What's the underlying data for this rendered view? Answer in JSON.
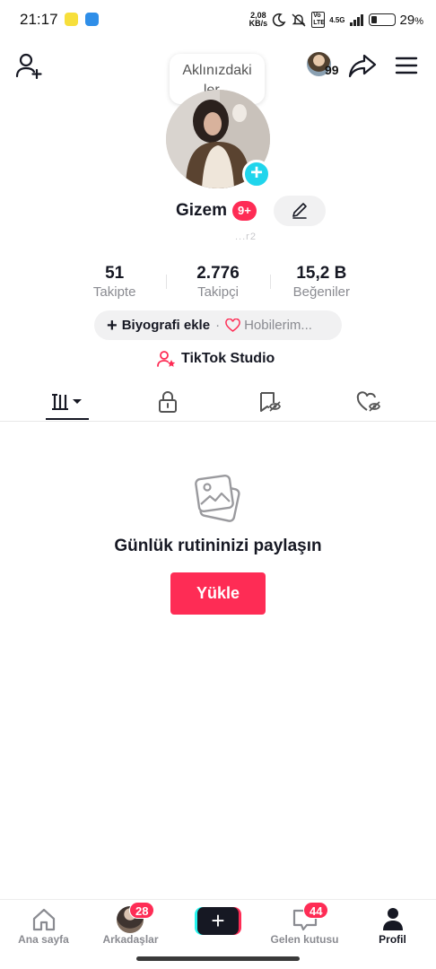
{
  "status_bar": {
    "time": "21:17",
    "net_speed_value": "2,08",
    "net_speed_unit": "KB/s",
    "network": "4.5G",
    "volte": "Vo LTE",
    "battery_percent": "29",
    "battery_symbol": "%",
    "battery_level": 0.29
  },
  "header": {
    "tooltip_line1": "Aklınızdaki",
    "tooltip_line2": "ler...",
    "views_count": "99"
  },
  "profile": {
    "name": "Gizem",
    "notification_badge": "9+",
    "faded_text": "...r2",
    "stats": [
      {
        "value": "51",
        "label": "Takipte"
      },
      {
        "value": "2.776",
        "label": "Takipçi"
      },
      {
        "value": "15,2 B",
        "label": "Beğeniler"
      }
    ],
    "bio_add": "Biyografi ekle",
    "bio_separator": "·",
    "hobbies": "Hobilerim...",
    "studio": "TikTok Studio"
  },
  "tabs": [
    {
      "icon": "videos-grid-icon",
      "active": true
    },
    {
      "icon": "lock-icon",
      "active": false
    },
    {
      "icon": "saved-favorites-icon",
      "active": false
    },
    {
      "icon": "liked-hidden-icon",
      "active": false
    }
  ],
  "empty_state": {
    "title": "Günlük rutininizi paylaşın",
    "button": "Yükle"
  },
  "bottom_nav": [
    {
      "label": "Ana sayfa",
      "icon": "home-icon",
      "active": false
    },
    {
      "label": "Arkadaşlar",
      "icon": "friends-avatar",
      "badge": "28",
      "active": false
    },
    {
      "label": "",
      "icon": "create-plus-icon",
      "active": false
    },
    {
      "label": "Gelen kutusu",
      "icon": "inbox-icon",
      "badge": "44",
      "active": false
    },
    {
      "label": "Profil",
      "icon": "profile-icon",
      "active": true
    }
  ],
  "colors": {
    "accent": "#fe2c55",
    "cyan": "#20d5ec",
    "text": "#161823",
    "muted": "#8a8b91"
  }
}
